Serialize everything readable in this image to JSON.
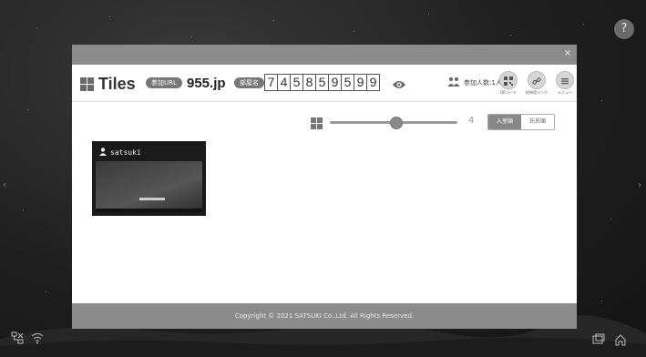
{
  "app": {
    "logo_text": "Tiles",
    "url_badge": "参加URL",
    "url_value": "955.jp",
    "room_badge": "部屋名",
    "room_digits": [
      "7",
      "4",
      "5",
      "8",
      "5",
      "9",
      "5",
      "9",
      "9"
    ],
    "participants_label": "参加人数:1人",
    "buttons": {
      "qr_label": "QRコード",
      "invite_label": "招待用リンク",
      "menu_label": "メニュー"
    },
    "close_glyph": "×"
  },
  "toolbar": {
    "tile_size_value": "4",
    "tile_size_fraction": 0.52,
    "sort_options": [
      "入室順",
      "氏名順"
    ],
    "sort_selected": "入室順"
  },
  "tiles": [
    {
      "name": "satsuki"
    }
  ],
  "footer": {
    "copyright": "Copyright © 2021 SATSUKI Co.,Ltd. All Rights Reserved."
  },
  "desktop": {
    "help_glyph": "?",
    "icons": [
      "network-icon",
      "wifi-icon",
      "screen-icon",
      "home-icon"
    ]
  },
  "colors": {
    "bar_gray": "#8c8c8c",
    "accent_gray": "#777777"
  }
}
